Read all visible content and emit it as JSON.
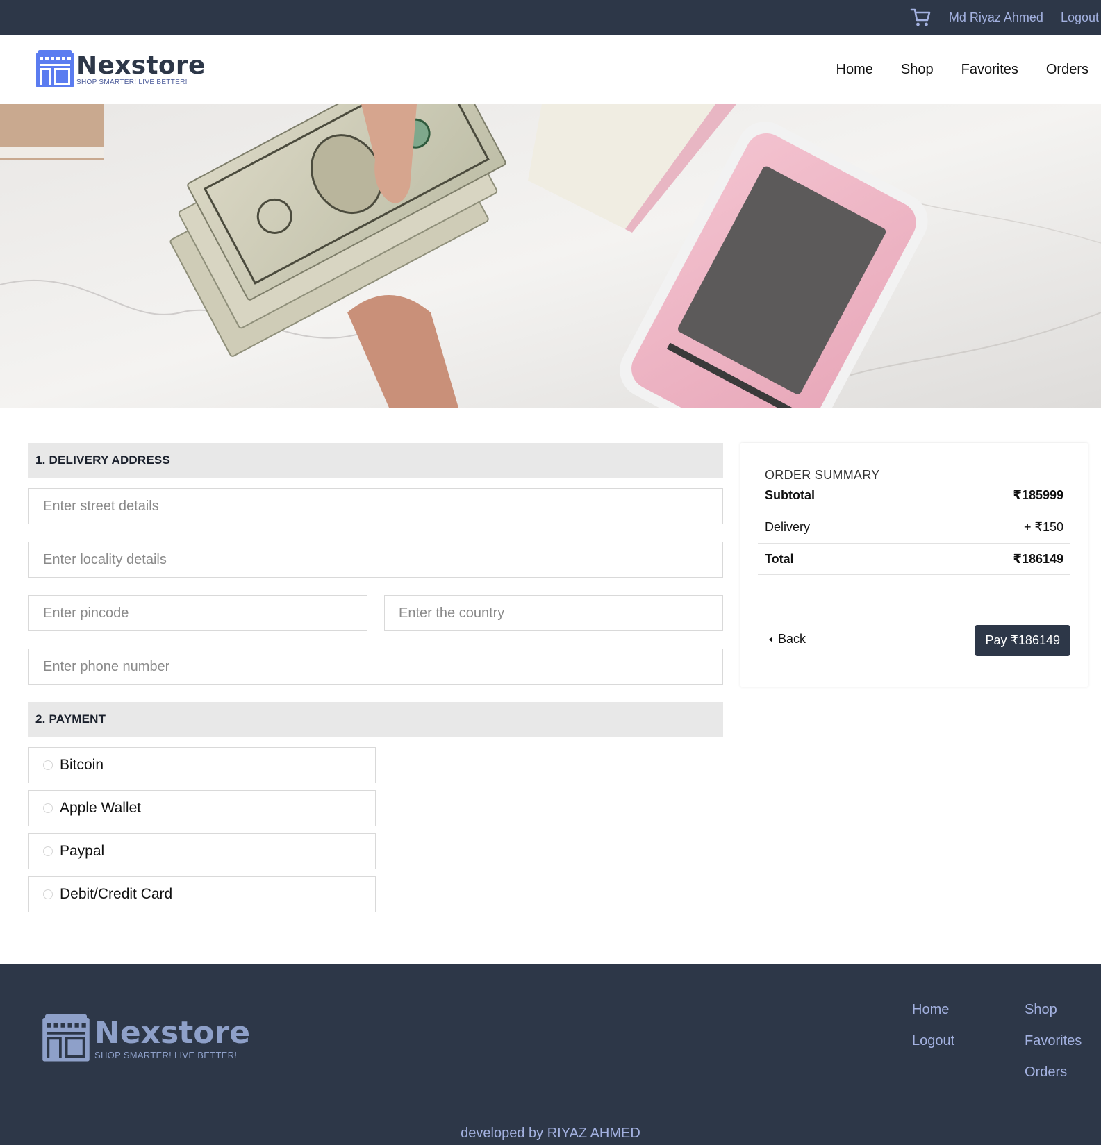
{
  "topbar": {
    "cart_icon": "shopping-cart-icon",
    "user_name": "Md Riyaz Ahmed",
    "logout": "Logout"
  },
  "brand": {
    "name": "Nexstore",
    "tagline": "SHOP SMARTER! LIVE BETTER!"
  },
  "nav": {
    "items": [
      "Home",
      "Shop",
      "Favorites",
      "Orders"
    ]
  },
  "checkout": {
    "delivery_heading": "1. DELIVERY ADDRESS",
    "street_placeholder": "Enter street details",
    "locality_placeholder": "Enter locality details",
    "pincode_placeholder": "Enter pincode",
    "country_placeholder": "Enter the country",
    "phone_placeholder": "Enter phone number",
    "payment_heading": "2. PAYMENT",
    "payment_options": [
      "Bitcoin",
      "Apple Wallet",
      "Paypal",
      "Debit/Credit Card"
    ]
  },
  "summary": {
    "title": "ORDER SUMMARY",
    "subtotal_label": "Subtotal",
    "subtotal_value": "₹185999",
    "delivery_label": "Delivery",
    "delivery_value": "+ ₹150",
    "total_label": "Total",
    "total_value": "₹186149",
    "back_label": "Back",
    "pay_label": "Pay ₹186149"
  },
  "footer": {
    "links_col1": [
      "Home",
      "Logout"
    ],
    "links_col2": [
      "Shop",
      "Favorites",
      "Orders"
    ],
    "credit": "developed by RIYAZ AHMED"
  },
  "colors": {
    "dark": "#2d3748",
    "link": "#a3b1e0",
    "logo_blue": "#5b7cf0"
  }
}
